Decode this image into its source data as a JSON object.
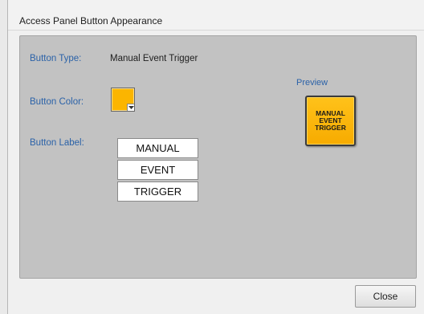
{
  "window": {
    "title": "Access Panel Button Appearance"
  },
  "form": {
    "button_type_label": "Button Type:",
    "button_type_value": "Manual Event Trigger",
    "button_color_label": "Button Color:",
    "button_color_value": "#fbb500",
    "button_label_label": "Button Label:",
    "label_lines": [
      "MANUAL",
      "EVENT",
      "TRIGGER"
    ]
  },
  "preview": {
    "heading": "Preview",
    "lines": [
      "MANUAL",
      "EVENT",
      "TRIGGER"
    ],
    "color": "#fbb500"
  },
  "footer": {
    "close_label": "Close"
  },
  "icons": {
    "color_dropdown": "chevron-down-icon"
  }
}
